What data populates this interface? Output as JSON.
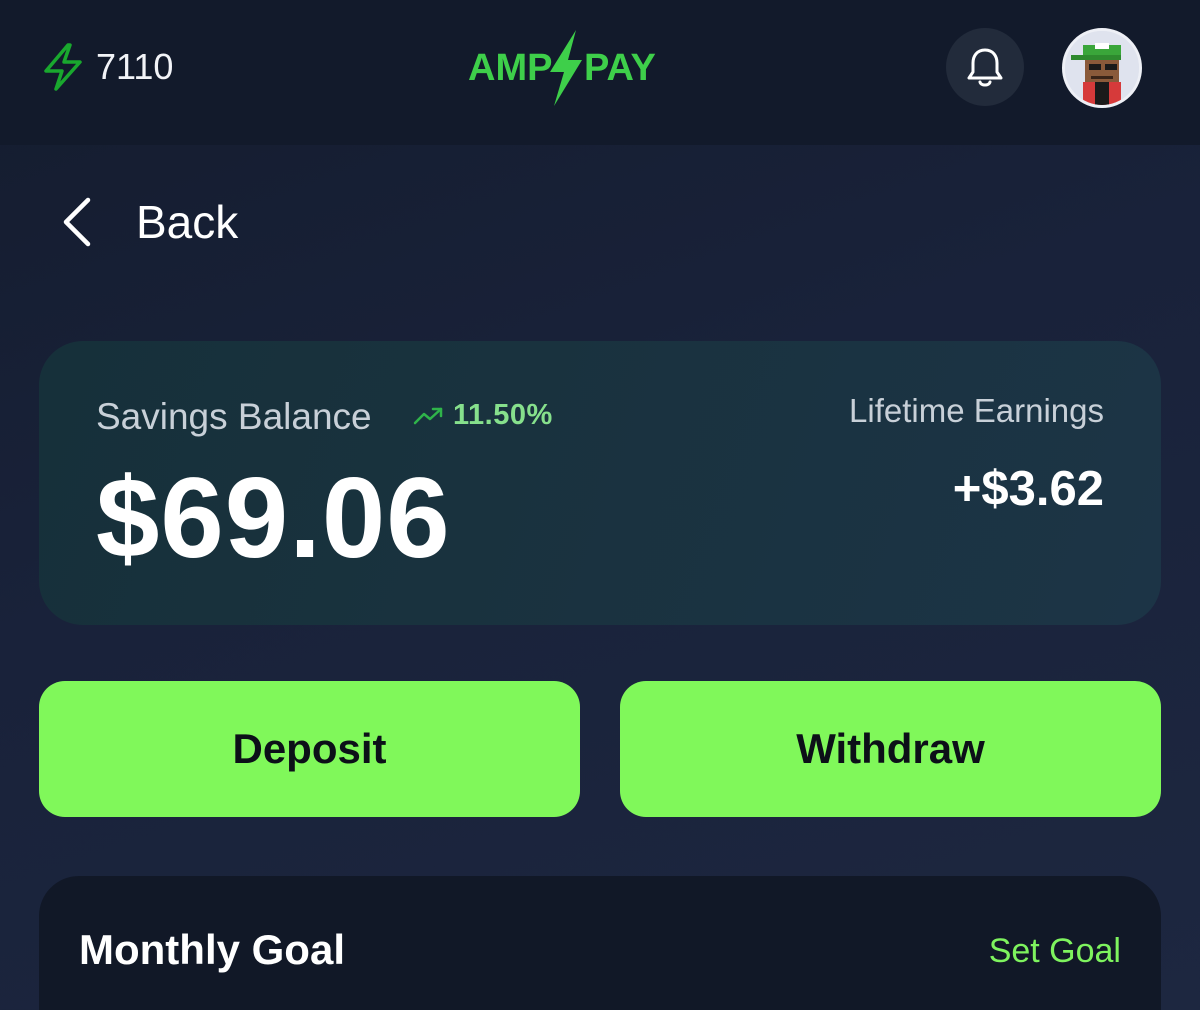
{
  "header": {
    "points_value": "7110",
    "points_icon": "lightning-icon",
    "brand_left": "AMP",
    "brand_right": "PAY",
    "notifications_icon": "bell-icon",
    "avatar_icon": "pixel-avatar"
  },
  "nav": {
    "back_label": "Back",
    "back_icon": "chevron-left-icon"
  },
  "balance": {
    "label": "Savings Balance",
    "rate": "11.50%",
    "rate_icon": "trending-up-icon",
    "amount": "$69.06",
    "lifetime_label": "Lifetime Earnings",
    "lifetime_value": "+$3.62"
  },
  "actions": {
    "deposit_label": "Deposit",
    "withdraw_label": "Withdraw"
  },
  "goal": {
    "title": "Monthly Goal",
    "set_label": "Set Goal"
  },
  "colors": {
    "accent_green": "#80f85a",
    "brand_green": "#3ecf4a",
    "background": "#141c2e",
    "card": "#17313c"
  }
}
